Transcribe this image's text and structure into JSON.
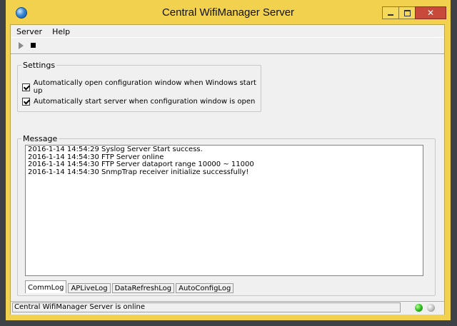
{
  "window": {
    "title": "Central WifiManager Server",
    "close_glyph": "✕"
  },
  "menu": {
    "items": [
      {
        "label": "Server"
      },
      {
        "label": "Help"
      }
    ]
  },
  "toolbar": {
    "start_icon": "play-icon",
    "stop_icon": "stop-icon"
  },
  "settings": {
    "legend": "Settings",
    "options": [
      {
        "label": "Automatically open configuration window when Windows start up",
        "checked": true
      },
      {
        "label": "Automatically start server when configuration window is open",
        "checked": true
      }
    ]
  },
  "message": {
    "legend": "Message",
    "log": [
      "2016-1-14 14:54:29 Syslog Server Start success.",
      "2016-1-14 14:54:30 FTP Server online",
      "2016-1-14 14:54:30 FTP Server dataport range 10000 ~ 11000",
      "2016-1-14 14:54:30 SnmpTrap receiver initialize successfully!"
    ],
    "tabs": [
      {
        "label": "CommLog",
        "active": true
      },
      {
        "label": "APLiveLog",
        "active": false
      },
      {
        "label": "DataRefreshLog",
        "active": false
      },
      {
        "label": "AutoConfigLog",
        "active": false
      }
    ]
  },
  "status": {
    "text": "Central WifiManager Server is online",
    "indicators": [
      {
        "name": "online-indicator",
        "color": "#2fbf1e"
      },
      {
        "name": "idle-indicator",
        "color": "#bdbdbd"
      }
    ]
  },
  "colors": {
    "window_frame": "#f1d14e",
    "desktop": "#3e4146",
    "close_button": "#c74a3a"
  }
}
